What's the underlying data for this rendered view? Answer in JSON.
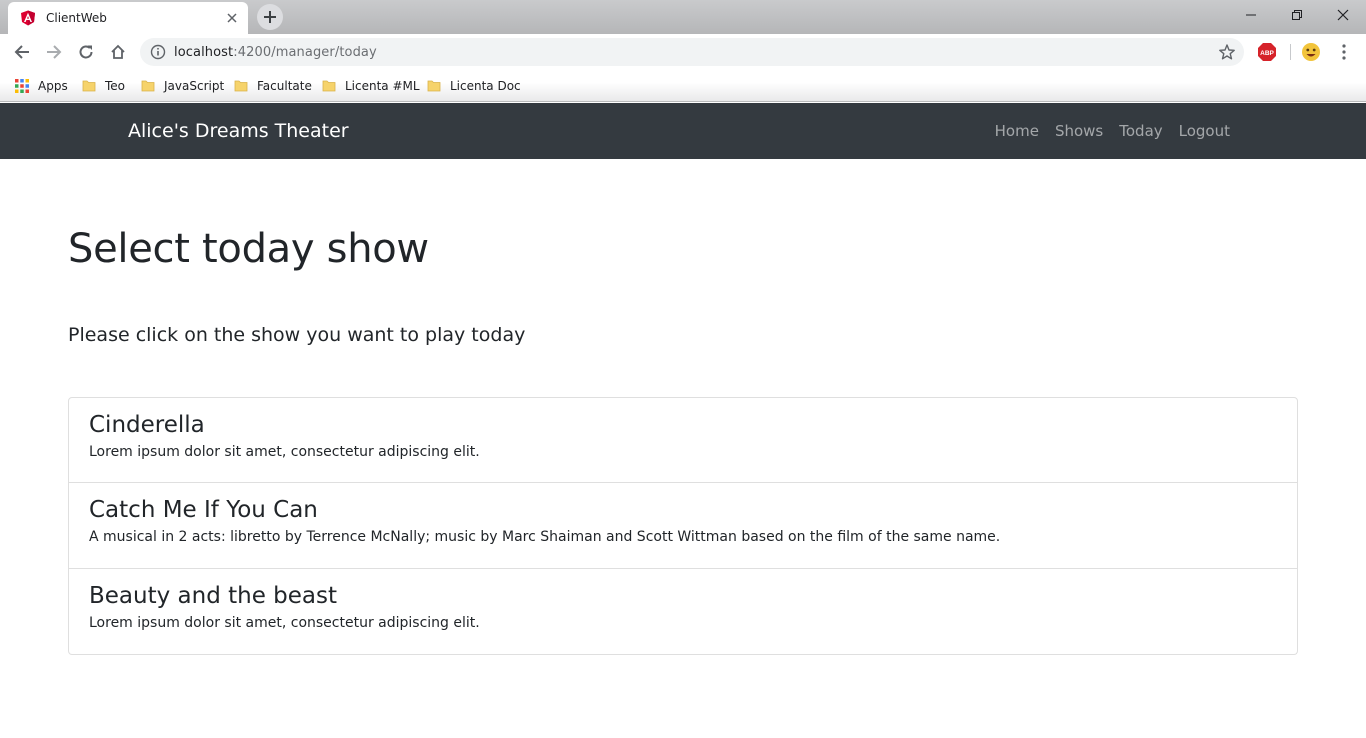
{
  "browser": {
    "tab": {
      "title": "ClientWeb",
      "favicon": "angular-icon"
    },
    "url": {
      "host": "localhost",
      "path": ":4200/manager/today"
    },
    "extensions": [
      {
        "name": "adblock-plus-icon",
        "label": "ABP"
      },
      {
        "name": "profile-avatar-icon"
      }
    ],
    "bookmarks": [
      {
        "label": "Apps",
        "icon": "apps-grid-icon"
      },
      {
        "label": "Teo",
        "icon": "folder-icon"
      },
      {
        "label": "JavaScript",
        "icon": "folder-icon"
      },
      {
        "label": "Facultate",
        "icon": "folder-icon"
      },
      {
        "label": "Licenta #ML",
        "icon": "folder-icon"
      },
      {
        "label": "Licenta Doc",
        "icon": "folder-icon"
      }
    ]
  },
  "navbar": {
    "brand": "Alice's Dreams Theater",
    "links": [
      "Home",
      "Shows",
      "Today",
      "Logout"
    ],
    "background": "#343a40"
  },
  "main": {
    "title": "Select today show",
    "subtitle": "Please click on the show you want to play today",
    "shows": [
      {
        "name": "Cinderella",
        "description": "Lorem ipsum dolor sit amet, consectetur adipiscing elit."
      },
      {
        "name": "Catch Me If You Can",
        "description": "A musical in 2 acts: libretto by Terrence McNally; music by Marc Shaiman and Scott Wittman based on the film of the same name."
      },
      {
        "name": "Beauty and the beast",
        "description": "Lorem ipsum dolor sit amet, consectetur adipiscing elit."
      }
    ]
  }
}
